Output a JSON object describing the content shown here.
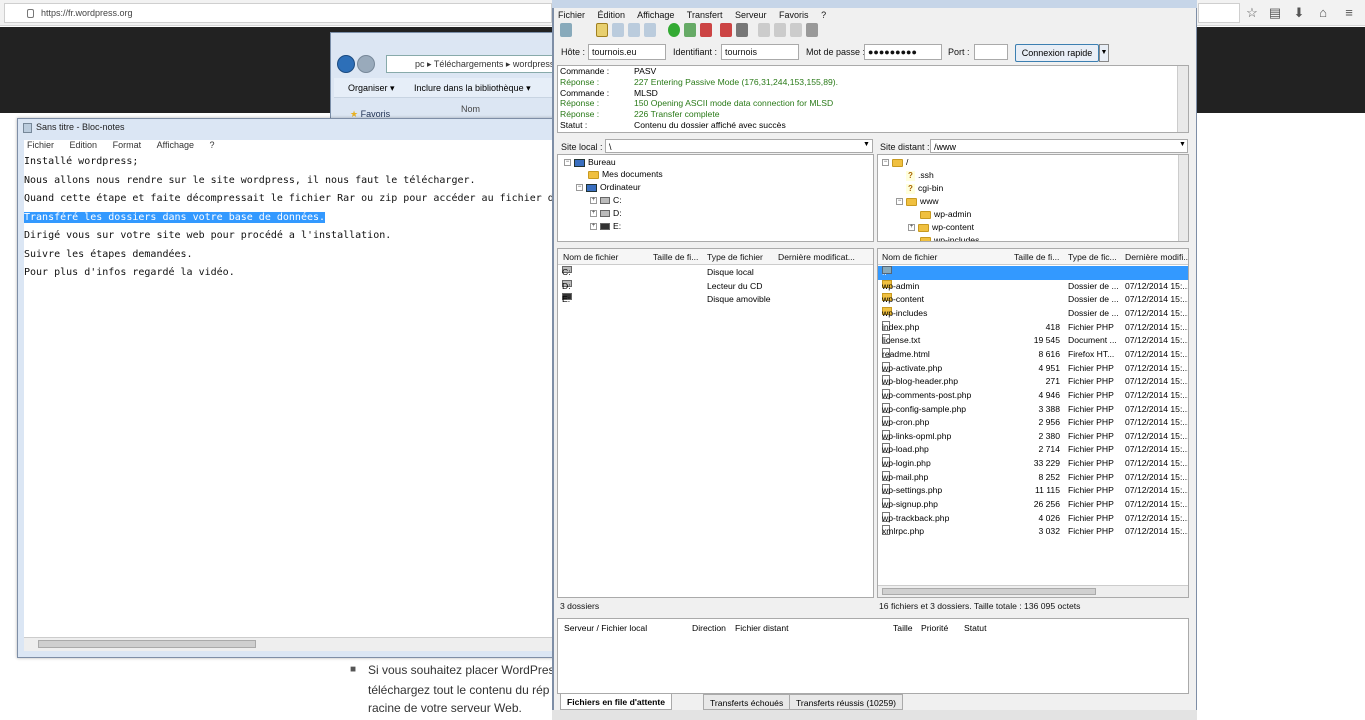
{
  "browser": {
    "url": "https://fr.wordpress.org"
  },
  "page": {
    "bullet": "■",
    "line1": "Si vous souhaitez placer WordPress",
    "line2": "téléchargez tout le contenu du rép",
    "line3": "racine de votre serveur Web."
  },
  "explorer": {
    "path": "pc  ▸  Téléchargements  ▸  wordpress",
    "organize": "Organiser ▾",
    "library": "Inclure dans la bibliothèque ▾",
    "col_name": "Nom",
    "favorites": "Favoris"
  },
  "notepad": {
    "title": "Sans titre - Bloc-notes",
    "menu": [
      "Fichier",
      "Edition",
      "Format",
      "Affichage",
      "?"
    ],
    "lines": [
      "Installé wordpress;",
      "Nous allons nous rendre sur le site wordpress, il nous faut le télécharger.",
      "Quand cette étape et faite décompressait le fichier Rar ou zip pour accéder au fichier de ba",
      "Transféré les dossiers dans votre base de données.",
      "Dirigé vous sur votre site web pour procédé a l'installation.",
      "Suivre les étapes demandées.",
      "Pour plus d'infos regardé la vidéo."
    ]
  },
  "filezilla": {
    "menu": [
      "Fichier",
      "Édition",
      "Affichage",
      "Transfert",
      "Serveur",
      "Favoris",
      "?"
    ],
    "quickconnect": {
      "host_label": "Hôte :",
      "host": "tournois.eu",
      "user_label": "Identifiant :",
      "user": "tournois",
      "pass_label": "Mot de passe :",
      "pass": "●●●●●●●●●",
      "port_label": "Port :",
      "port": "",
      "connect": "Connexion rapide",
      "dropdown": "▼"
    },
    "log": [
      {
        "k": "Commande :",
        "v": "PASV",
        "cls": ""
      },
      {
        "k": "Réponse :",
        "v": "227 Entering Passive Mode (176,31,244,153,155,89).",
        "cls": "green"
      },
      {
        "k": "Commande :",
        "v": "MLSD",
        "cls": ""
      },
      {
        "k": "Réponse :",
        "v": "150 Opening ASCII mode data connection for MLSD",
        "cls": "green"
      },
      {
        "k": "Réponse :",
        "v": "226 Transfer complete",
        "cls": "green"
      },
      {
        "k": "Statut :",
        "v": "Contenu du dossier affiché avec succès",
        "cls": ""
      }
    ],
    "local": {
      "label": "Site local :",
      "path": "\\",
      "tree": [
        "Bureau",
        "Mes documents",
        "Ordinateur",
        "C:",
        "D:",
        "E:"
      ],
      "headers": [
        "Nom de fichier",
        "Taille de fi...",
        "Type de fichier",
        "Dernière modificat..."
      ],
      "files": [
        {
          "name": "C:",
          "type": "Disque local"
        },
        {
          "name": "D:",
          "type": "Lecteur du CD"
        },
        {
          "name": "E:",
          "type": "Disque amovible"
        }
      ],
      "status": "3 dossiers"
    },
    "remote": {
      "label": "Site distant :",
      "path": "/www",
      "tree": [
        "/",
        ".ssh",
        "cgi-bin",
        "www",
        "wp-admin",
        "wp-content",
        "wp-includes"
      ],
      "headers": [
        "Nom de fichier",
        "Taille de fi...",
        "Type de fic...",
        "Dernière modifi..."
      ],
      "files": [
        {
          "name": "..",
          "size": "",
          "type": "",
          "date": "",
          "kind": "up"
        },
        {
          "name": "wp-admin",
          "size": "",
          "type": "Dossier de ...",
          "date": "07/12/2014 15:...",
          "kind": "dir"
        },
        {
          "name": "wp-content",
          "size": "",
          "type": "Dossier de ...",
          "date": "07/12/2014 15:...",
          "kind": "dir"
        },
        {
          "name": "wp-includes",
          "size": "",
          "type": "Dossier de ...",
          "date": "07/12/2014 15:...",
          "kind": "dir"
        },
        {
          "name": "index.php",
          "size": "418",
          "type": "Fichier PHP",
          "date": "07/12/2014 15:...",
          "kind": "file"
        },
        {
          "name": "license.txt",
          "size": "19 545",
          "type": "Document ...",
          "date": "07/12/2014 15:...",
          "kind": "file"
        },
        {
          "name": "readme.html",
          "size": "8 616",
          "type": "Firefox HT...",
          "date": "07/12/2014 15:...",
          "kind": "file"
        },
        {
          "name": "wp-activate.php",
          "size": "4 951",
          "type": "Fichier PHP",
          "date": "07/12/2014 15:...",
          "kind": "file"
        },
        {
          "name": "wp-blog-header.php",
          "size": "271",
          "type": "Fichier PHP",
          "date": "07/12/2014 15:...",
          "kind": "file"
        },
        {
          "name": "wp-comments-post.php",
          "size": "4 946",
          "type": "Fichier PHP",
          "date": "07/12/2014 15:...",
          "kind": "file"
        },
        {
          "name": "wp-config-sample.php",
          "size": "3 388",
          "type": "Fichier PHP",
          "date": "07/12/2014 15:...",
          "kind": "file"
        },
        {
          "name": "wp-cron.php",
          "size": "2 956",
          "type": "Fichier PHP",
          "date": "07/12/2014 15:...",
          "kind": "file"
        },
        {
          "name": "wp-links-opml.php",
          "size": "2 380",
          "type": "Fichier PHP",
          "date": "07/12/2014 15:...",
          "kind": "file"
        },
        {
          "name": "wp-load.php",
          "size": "2 714",
          "type": "Fichier PHP",
          "date": "07/12/2014 15:...",
          "kind": "file"
        },
        {
          "name": "wp-login.php",
          "size": "33 229",
          "type": "Fichier PHP",
          "date": "07/12/2014 15:...",
          "kind": "file"
        },
        {
          "name": "wp-mail.php",
          "size": "8 252",
          "type": "Fichier PHP",
          "date": "07/12/2014 15:...",
          "kind": "file"
        },
        {
          "name": "wp-settings.php",
          "size": "11 115",
          "type": "Fichier PHP",
          "date": "07/12/2014 15:...",
          "kind": "file"
        },
        {
          "name": "wp-signup.php",
          "size": "26 256",
          "type": "Fichier PHP",
          "date": "07/12/2014 15:...",
          "kind": "file"
        },
        {
          "name": "wp-trackback.php",
          "size": "4 026",
          "type": "Fichier PHP",
          "date": "07/12/2014 15:...",
          "kind": "file"
        },
        {
          "name": "xmlrpc.php",
          "size": "3 032",
          "type": "Fichier PHP",
          "date": "07/12/2014 15:...",
          "kind": "file"
        }
      ],
      "status": "16 fichiers et 3 dossiers. Taille totale : 136 095 octets"
    },
    "queue": {
      "headers": [
        "Serveur / Fichier local",
        "Direction",
        "Fichier distant",
        "Taille",
        "Priorité",
        "Statut"
      ],
      "tabs": [
        "Fichiers en file d'attente",
        "Transferts échoués",
        "Transferts réussis (10259)"
      ]
    }
  },
  "colors": {
    "selection": "#3399ff",
    "log_green": "#2a7a18"
  }
}
